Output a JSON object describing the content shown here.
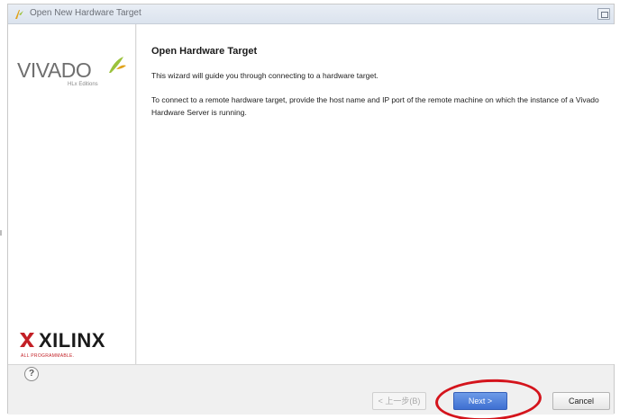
{
  "window": {
    "title": "Open New Hardware Target"
  },
  "sidebar": {
    "vivado_logo_text": "VIVADO",
    "vivado_logo_sub": "HLx Editions",
    "xilinx_logo_text": "XILINX",
    "xilinx_logo_sub": "ALL PROGRAMMABLE."
  },
  "content": {
    "heading": "Open Hardware Target",
    "paragraph_1": "This wizard will guide you through connecting to a hardware target.",
    "paragraph_2": "To connect to a remote hardware target, provide the host name and IP port of the remote machine on which the instance of a Vivado Hardware Server is running."
  },
  "footer": {
    "help_label": "?",
    "back_label": "< 上一步(B)",
    "next_label": "Next >",
    "cancel_label": "Cancel"
  },
  "colors": {
    "highlight_ring": "#d4141c",
    "next_button": "#3e6fd1",
    "xilinx_red": "#c32026",
    "vivado_green": "#9bc23c"
  }
}
